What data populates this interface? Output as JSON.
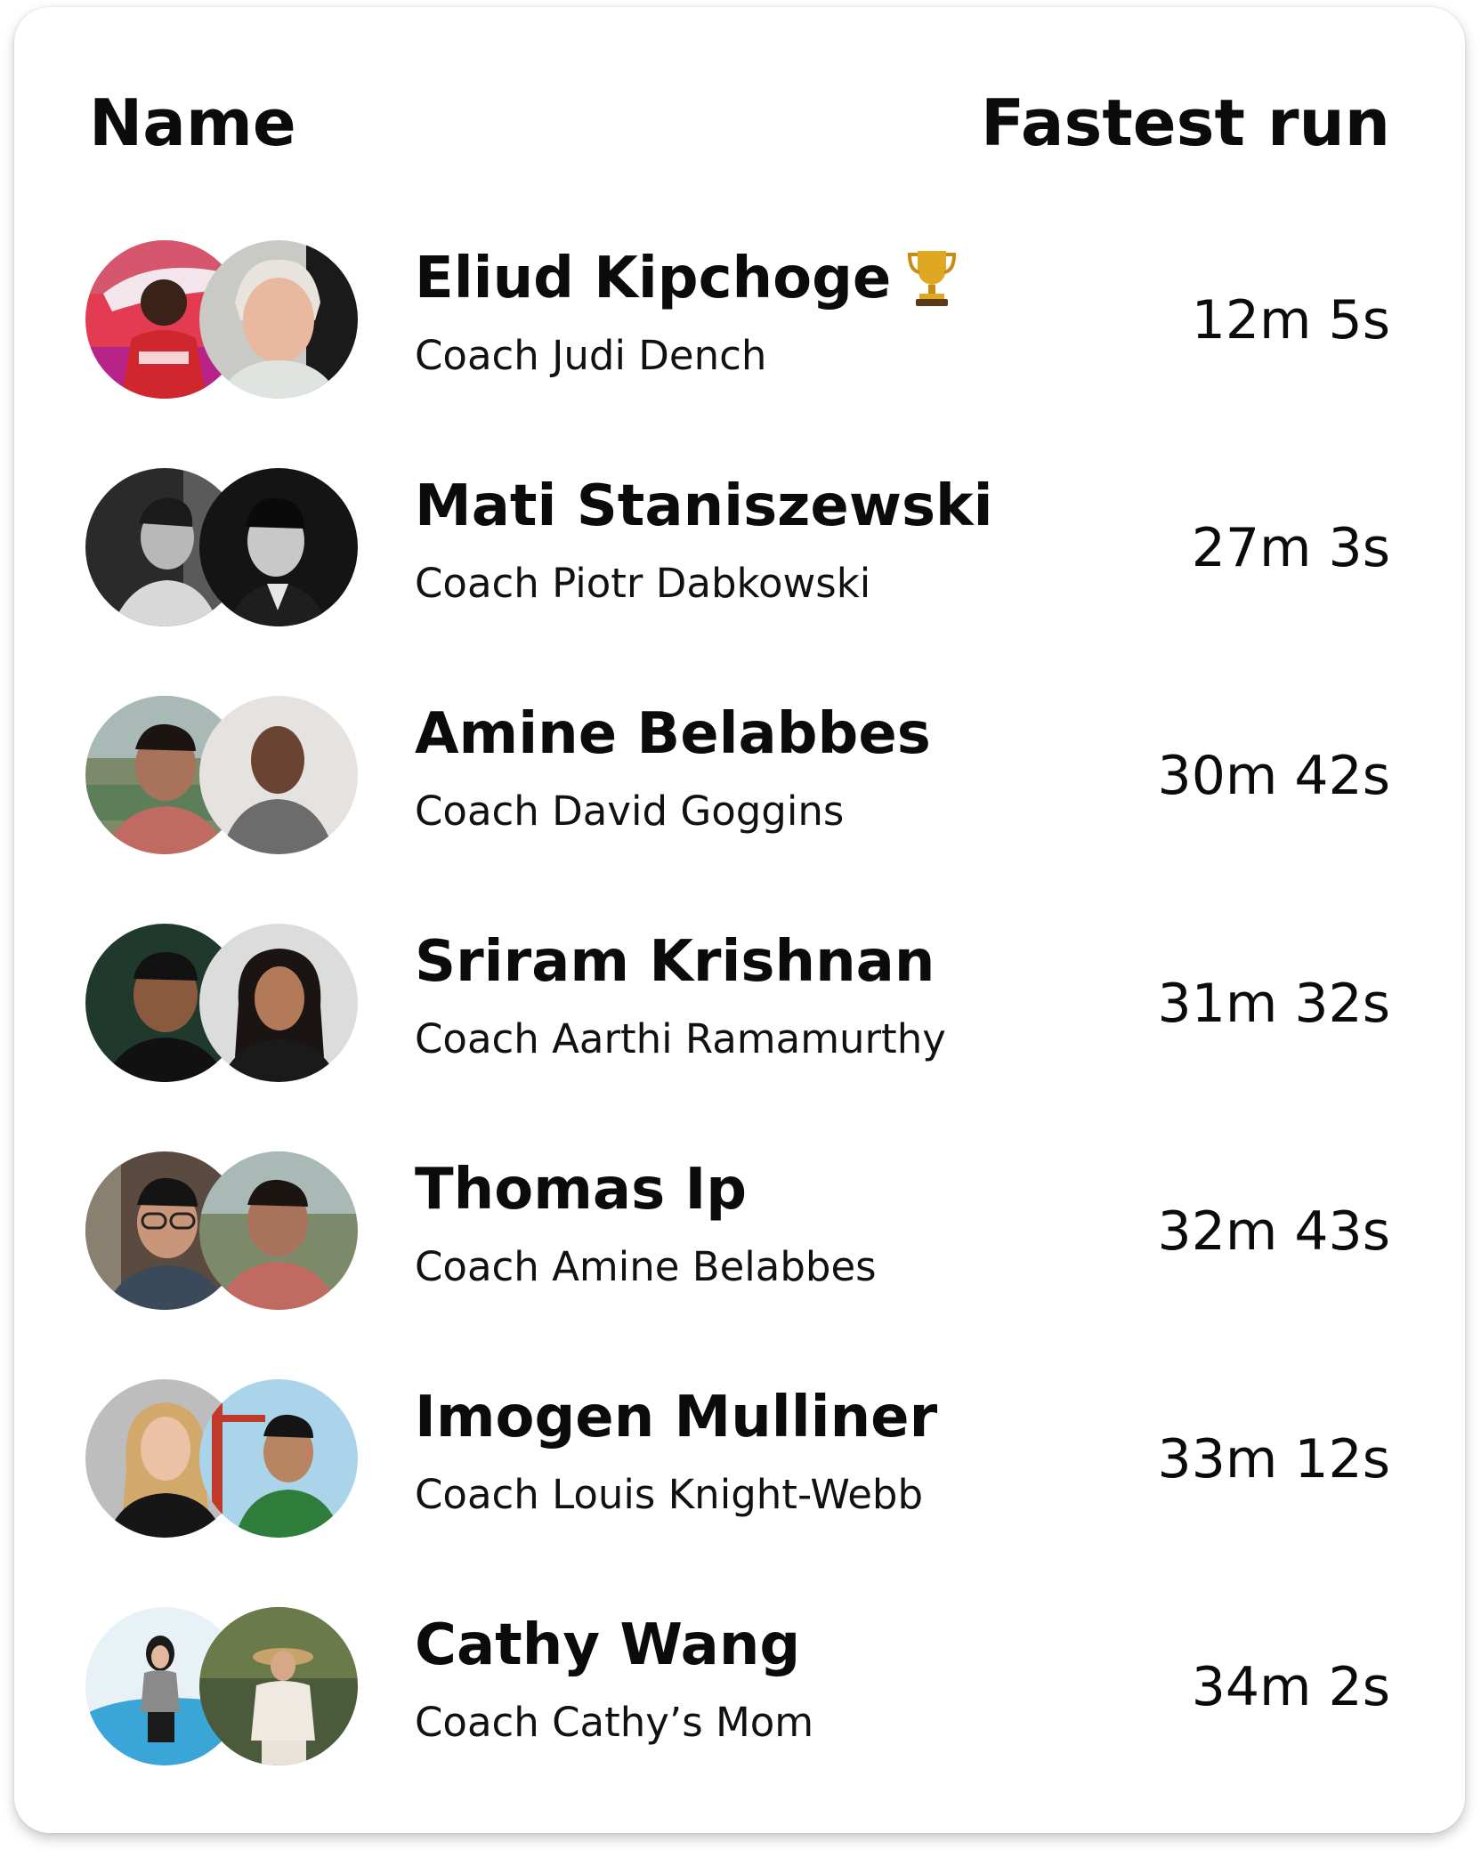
{
  "header": {
    "name_label": "Name",
    "fastest_run_label": "Fastest run"
  },
  "colors": {
    "text": "#0b0b0b",
    "background": "#ffffff",
    "trophy": "#d9a21b"
  },
  "leaderboard": [
    {
      "athlete": "Eliud Kipchoge",
      "coach": "Coach Judi Dench",
      "time": "12m 5s",
      "trophy": true
    },
    {
      "athlete": "Mati Staniszewski",
      "coach": "Coach Piotr Dabkowski",
      "time": "27m 3s",
      "trophy": false
    },
    {
      "athlete": "Amine Belabbes",
      "coach": "Coach David Goggins",
      "time": "30m 42s",
      "trophy": false
    },
    {
      "athlete": "Sriram Krishnan",
      "coach": "Coach Aarthi Ramamurthy",
      "time": "31m 32s",
      "trophy": false
    },
    {
      "athlete": "Thomas Ip",
      "coach": "Coach Amine Belabbes",
      "time": "32m 43s",
      "trophy": false
    },
    {
      "athlete": "Imogen Mulliner",
      "coach": "Coach Louis Knight-Webb",
      "time": "33m 12s",
      "trophy": false
    },
    {
      "athlete": "Cathy Wang",
      "coach": "Coach Cathy’s Mom",
      "time": "34m 2s",
      "trophy": false
    }
  ],
  "icons": {
    "trophy": "trophy-icon"
  }
}
